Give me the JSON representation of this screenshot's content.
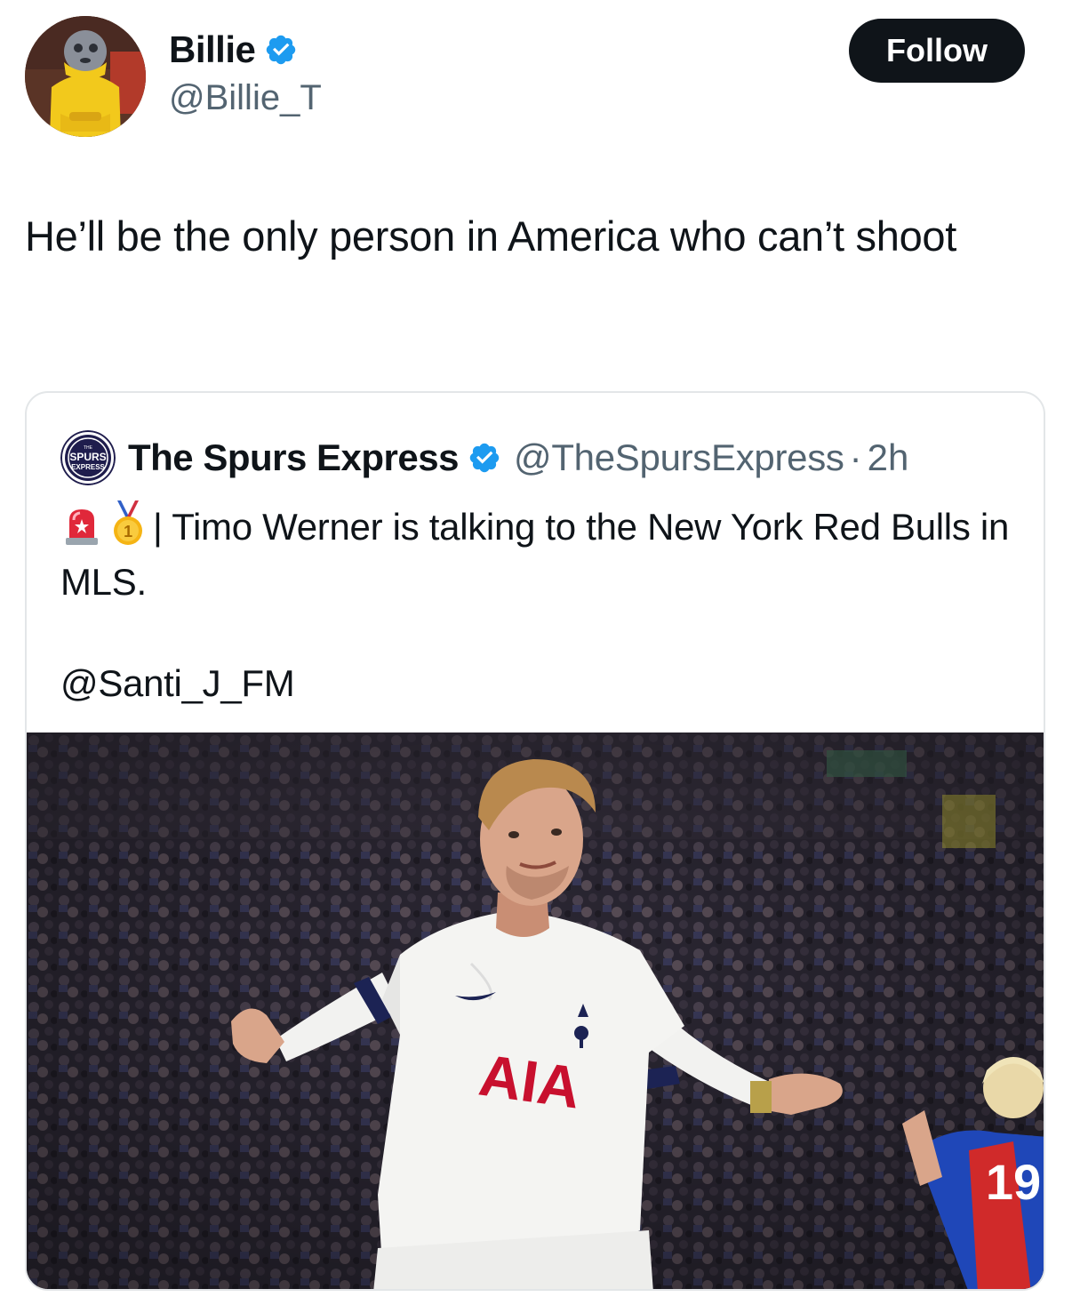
{
  "author": {
    "display_name": "Billie",
    "handle": "@Billie_T",
    "verified": true
  },
  "follow_button": {
    "label": "Follow"
  },
  "tweet": {
    "text": "He’ll be the only person in America who can’t shoot"
  },
  "quoted_tweet": {
    "display_name": "The Spurs Express",
    "handle": "@TheSpursExpress",
    "separator": "·",
    "time": "2h",
    "verified": true,
    "logo_text": [
      "THE",
      "SPURS",
      "EXPRESS"
    ],
    "emojis": [
      "siren-icon",
      "gold-medal-icon"
    ],
    "text": "| Timo Werner is talking to the New York Red Bulls in MLS.",
    "mention": "@Santi_J_FM",
    "media": {
      "shirt_sponsor": "AIA",
      "opponent_number": "19"
    }
  },
  "colors": {
    "text": "#0f1419",
    "secondary": "#536471",
    "verified_blue": "#1d9bf0",
    "follow_bg": "#0f1419",
    "border": "#e3e6e8"
  }
}
